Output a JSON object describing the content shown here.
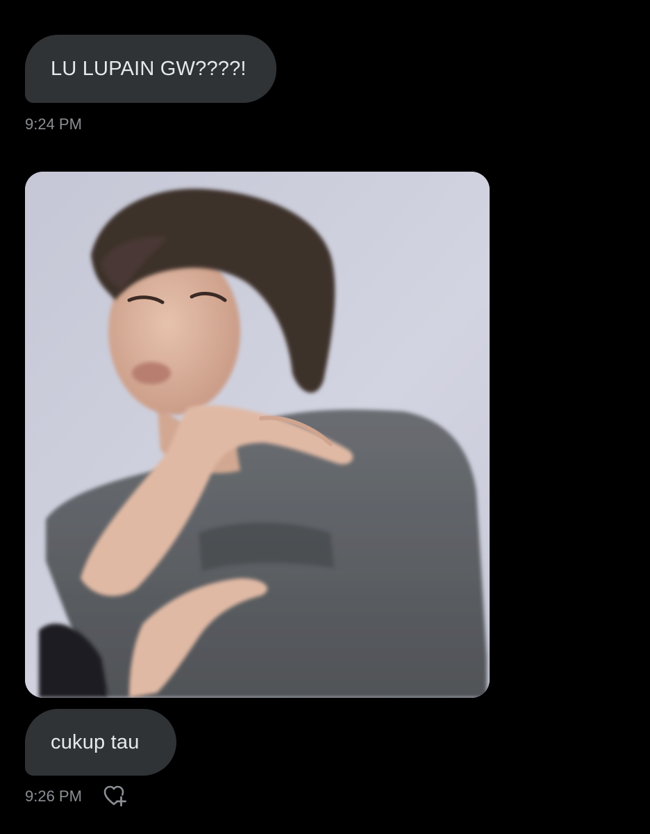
{
  "conversation": {
    "messages": [
      {
        "type": "text",
        "text": "LU LUPAIN GW????!",
        "time": "9:24 PM"
      },
      {
        "type": "image",
        "alt": "photo"
      },
      {
        "type": "text",
        "text": "cukup tau",
        "time": "9:26 PM"
      }
    ]
  },
  "icons": {
    "react": "heart-plus-icon"
  },
  "colors": {
    "background": "#000000",
    "bubble": "#2f3336",
    "bubble_text": "#e7e9ea",
    "timestamp": "#8b8f94"
  }
}
